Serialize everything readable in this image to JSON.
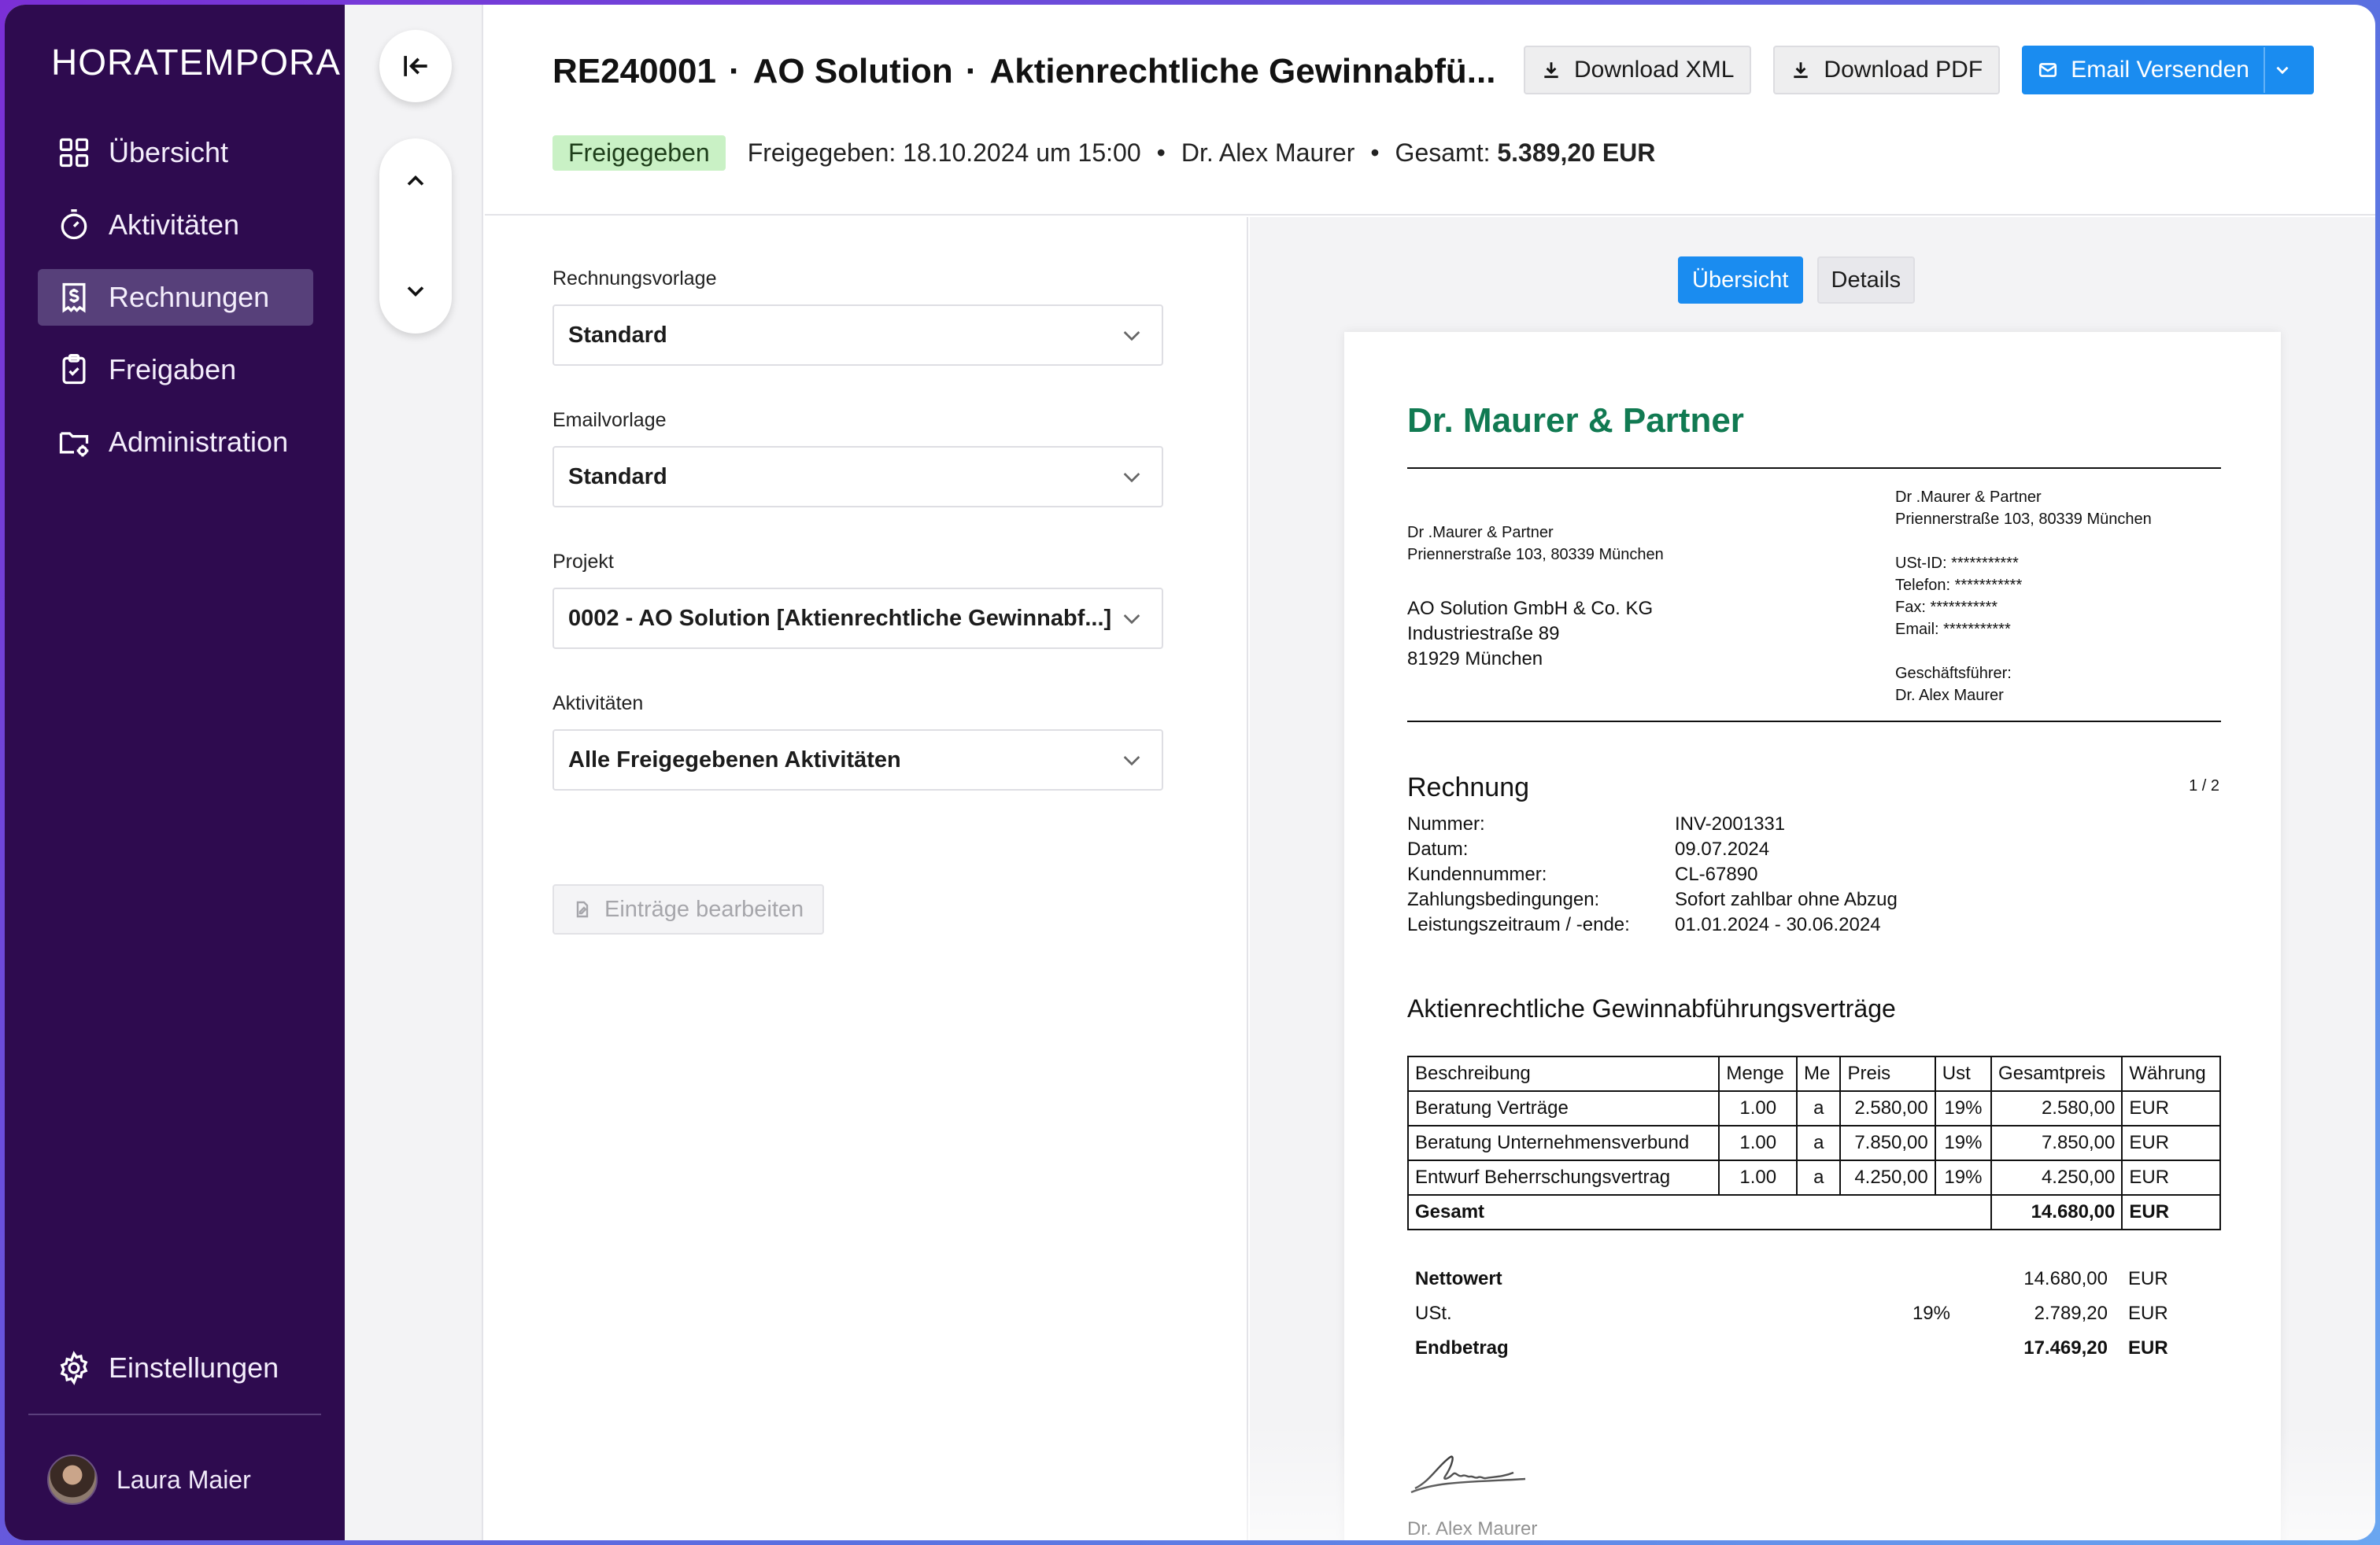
{
  "app": {
    "brand": "HORATEMPORA"
  },
  "sidebar": {
    "items": [
      {
        "label": "Übersicht",
        "icon": "grid-icon"
      },
      {
        "label": "Aktivitäten",
        "icon": "stopwatch-icon"
      },
      {
        "label": "Rechnungen",
        "icon": "invoice-icon",
        "active": true
      },
      {
        "label": "Freigaben",
        "icon": "clipboard-check-icon"
      },
      {
        "label": "Administration",
        "icon": "folder-gear-icon"
      }
    ],
    "settings_label": "Einstellungen",
    "user_name": "Laura Maier"
  },
  "header": {
    "invoice_id": "RE240001",
    "client": "AO Solution",
    "project": "Aktienrechtliche Gewinnabfü...",
    "separator": "·",
    "status": "Freigegeben",
    "approved_text": "Freigegeben: 18.10.2024 um 15:00",
    "approver": "Dr. Alex Maurer",
    "total_label": "Gesamt:",
    "total_value": "5.389,20 EUR",
    "bullet": "•",
    "download_xml": "Download XML",
    "download_pdf": "Download PDF",
    "email_send": "Email Versenden"
  },
  "form": {
    "template_label": "Rechnungsvorlage",
    "template_value": "Standard",
    "email_template_label": "Emailvorlage",
    "email_template_value": "Standard",
    "project_label": "Projekt",
    "project_value": "0002 - AO Solution [Aktienrechtliche Gewinnabf...]",
    "activities_label": "Aktivitäten",
    "activities_value": "Alle Freigegebenen Aktivitäten",
    "edit_entries": "Einträge bearbeiten"
  },
  "preview": {
    "tab_overview": "Übersicht",
    "tab_details": "Details",
    "company": "Dr. Maurer & Partner",
    "sender_name": "Dr .Maurer & Partner",
    "sender_address": "Priennerstraße 103, 80339 München",
    "recipient_line1": "AO Solution GmbH & Co. KG",
    "recipient_line2": "Industriestraße 89",
    "recipient_line3": "81929 München",
    "meta_name": "Dr .Maurer & Partner",
    "meta_address": "Priennerstraße 103, 80339 München",
    "ust_id": "USt-ID: ***********",
    "telefon": "Telefon: ***********",
    "fax": "Fax: ***********",
    "email": "Email: ***********",
    "ceo_label": "Geschäftsführer:",
    "ceo_name": "Dr. Alex Maurer",
    "doc_title": "Rechnung",
    "page": "1 / 2",
    "fields": [
      {
        "k": "Nummer:",
        "v": "INV-2001331"
      },
      {
        "k": "Datum:",
        "v": "09.07.2024"
      },
      {
        "k": "Kundennummer:",
        "v": "CL-67890"
      },
      {
        "k": "Zahlungsbedingungen:",
        "v": "Sofort zahlbar ohne Abzug"
      },
      {
        "k": "Leistungszeitraum / -ende:",
        "v": "01.01.2024 - 30.06.2024"
      }
    ],
    "project_title": "Aktienrechtliche Gewinnabführungsverträge",
    "table_headers": [
      "Beschreibung",
      "Menge",
      "Me",
      "Preis",
      "Ust",
      "Gesamtpreis",
      "Währung"
    ],
    "rows": [
      [
        "Beratung Verträge",
        "1.00",
        "a",
        "2.580,00",
        "19%",
        "2.580,00",
        "EUR"
      ],
      [
        "Beratung Unternehmensverbund",
        "1.00",
        "a",
        "7.850,00",
        "19%",
        "7.850,00",
        "EUR"
      ],
      [
        "Entwurf Beherrschungsvertrag",
        "1.00",
        "a",
        "4.250,00",
        "19%",
        "4.250,00",
        "EUR"
      ]
    ],
    "table_total_label": "Gesamt",
    "table_total_value": "14.680,00",
    "table_total_currency": "EUR",
    "net_label": "Nettowert",
    "net_value": "14.680,00",
    "net_currency": "EUR",
    "vat_label": "USt.",
    "vat_rate": "19%",
    "vat_value": "2.789,20",
    "vat_currency": "EUR",
    "final_label": "Endbetrag",
    "final_value": "17.469,20",
    "final_currency": "EUR",
    "signer": "Dr. Alex Maurer"
  },
  "colors": {
    "sidebar_bg": "#2e0b4f",
    "sidebar_active": "#57407a",
    "primary": "#1a8cf0",
    "status_badge": "#c9f1c5",
    "company_green": "#117a52"
  }
}
